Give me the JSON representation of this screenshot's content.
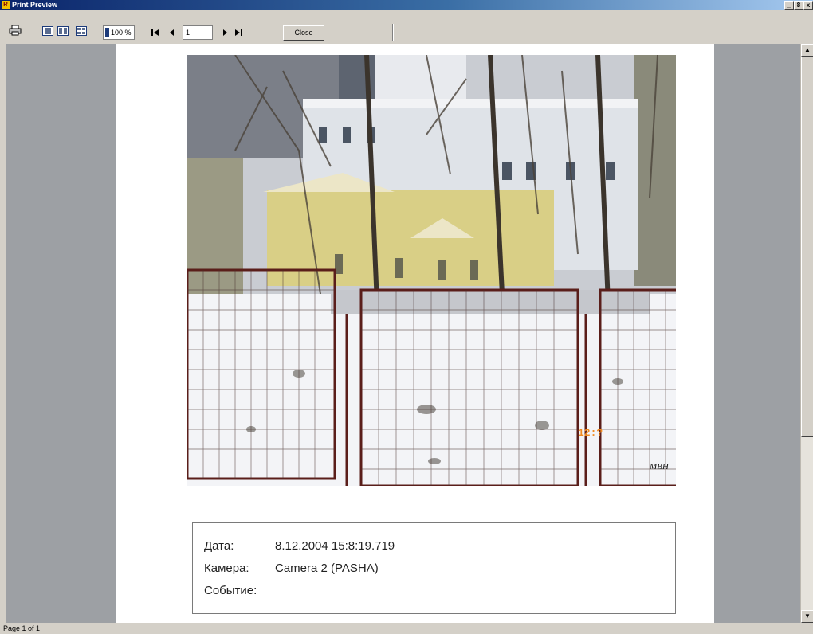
{
  "window": {
    "title": "Print Preview",
    "app_icon": "R",
    "min": "_",
    "max": "8",
    "close": "x"
  },
  "toolbar": {
    "zoom_value": "100 %",
    "page_value": "1",
    "close_label": "Close",
    "icons": [
      "printer-icon",
      "one-page-icon",
      "two-page-icon",
      "multi-page-icon",
      "first-page-icon",
      "prev-page-icon",
      "next-page-icon",
      "last-page-icon"
    ]
  },
  "report": {
    "photo_watermark": "MBH",
    "photo_overlay_digits": "12:?",
    "fields": [
      {
        "label": "Дата:",
        "value": "8.12.2004 15:8:19.719"
      },
      {
        "label": "Камера:",
        "value": "Camera 2 (PASHA)"
      },
      {
        "label": "Событие:",
        "value": ""
      }
    ]
  },
  "statusbar": {
    "text": "Page 1 of 1"
  }
}
